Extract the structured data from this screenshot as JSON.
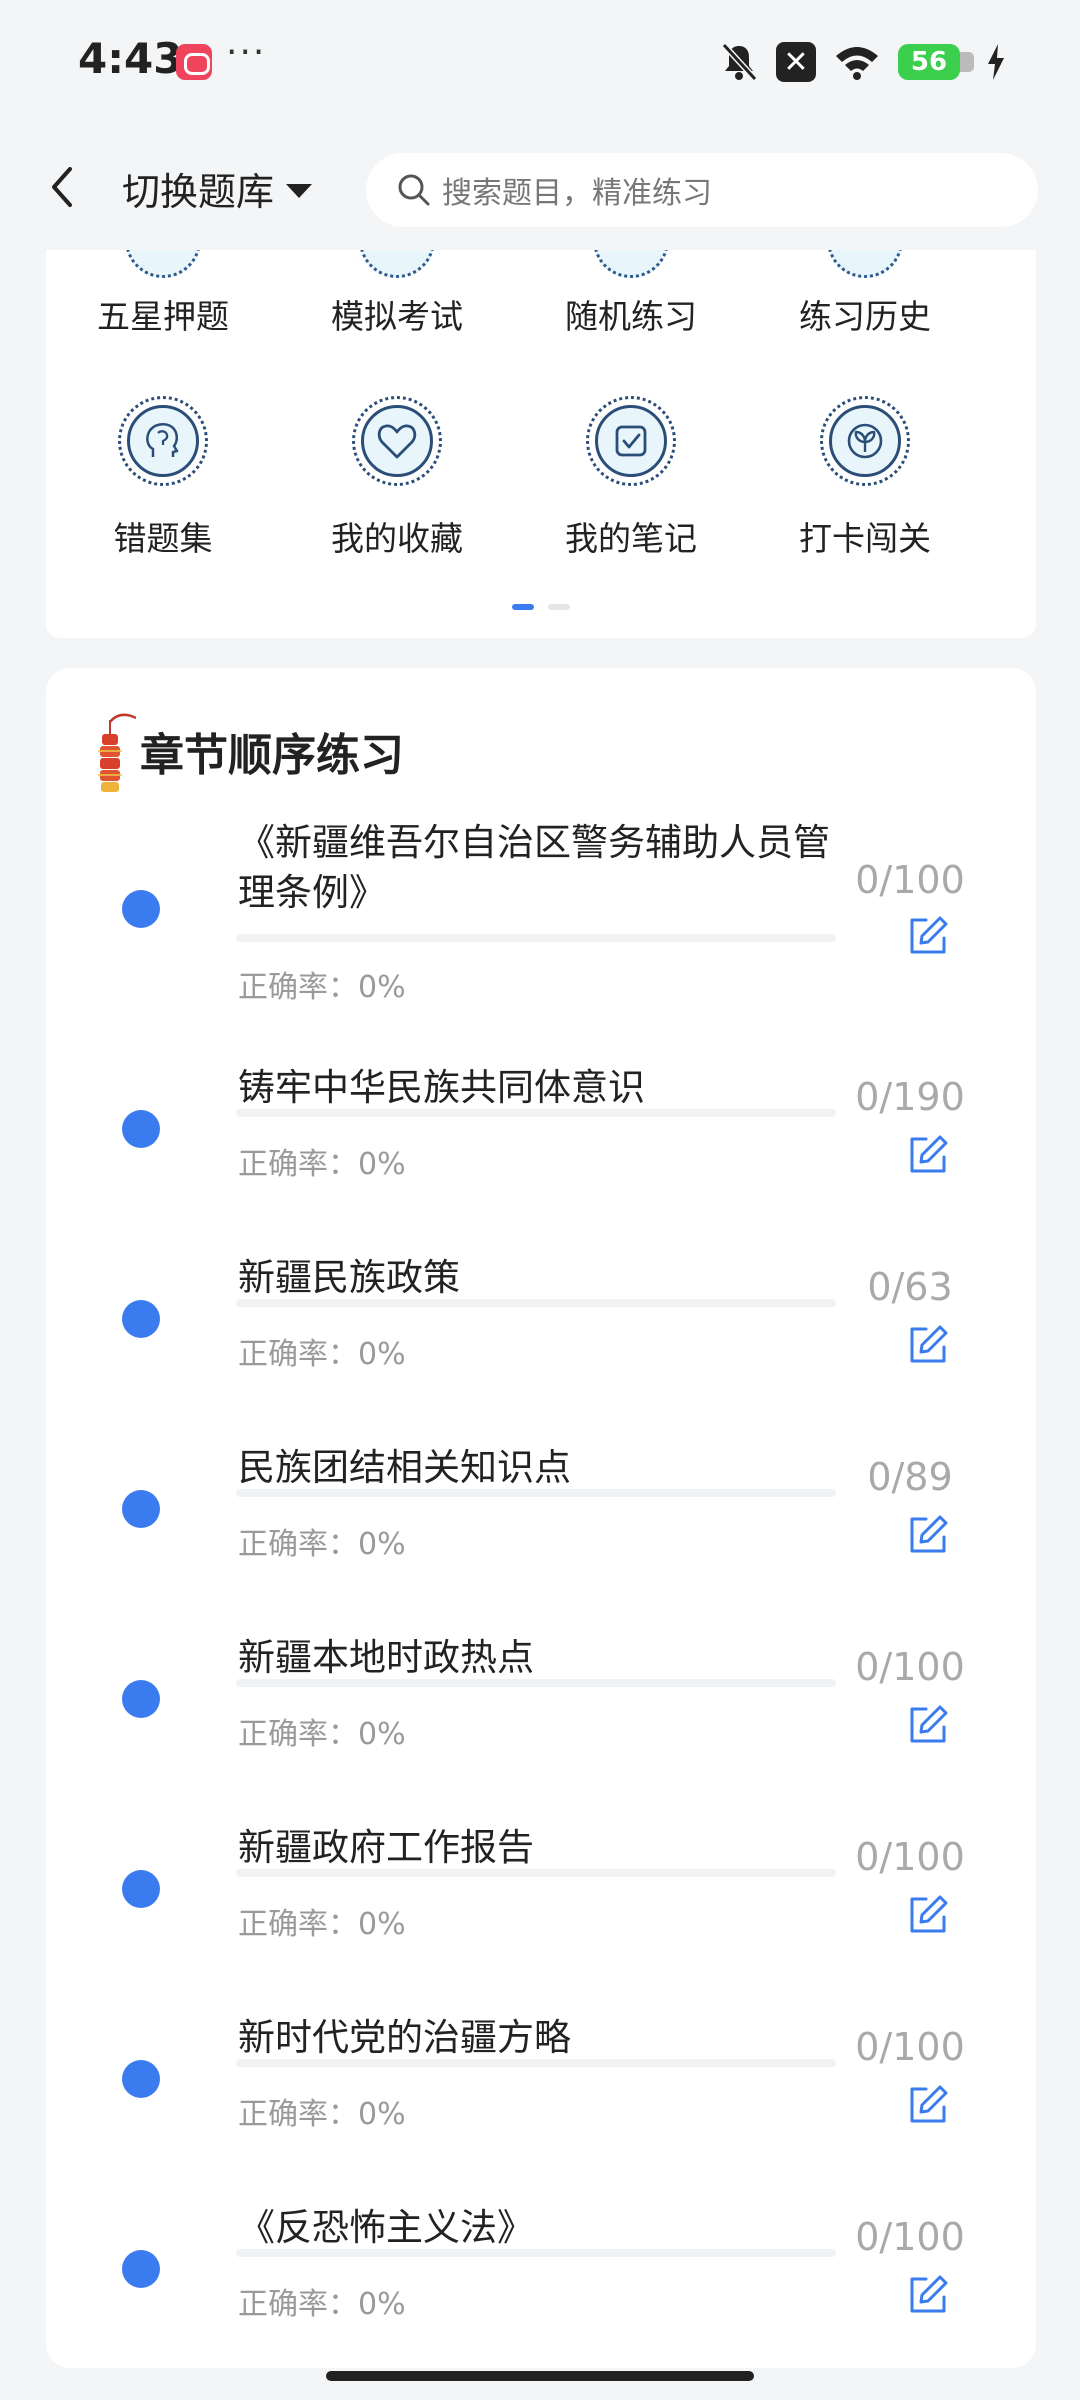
{
  "status_bar": {
    "time": "4:43",
    "dots": "···",
    "battery": "56"
  },
  "header": {
    "switch_bank_label": "切换题库",
    "search_placeholder": "搜索题目，精准练习"
  },
  "quick_grid": {
    "row1": [
      {
        "label": "五星押题",
        "icon": "star-exam-icon"
      },
      {
        "label": "模拟考试",
        "icon": "mock-exam-icon"
      },
      {
        "label": "随机练习",
        "icon": "random-practice-icon"
      },
      {
        "label": "练习历史",
        "icon": "history-icon"
      }
    ],
    "row2": [
      {
        "label": "错题集",
        "icon": "brain-head-icon"
      },
      {
        "label": "我的收藏",
        "icon": "heart-icon"
      },
      {
        "label": "我的笔记",
        "icon": "note-check-icon"
      },
      {
        "label": "打卡闯关",
        "icon": "sprout-icon"
      }
    ],
    "page_count": 2,
    "active_page": 1
  },
  "chapters": {
    "title": "章节顺序练习",
    "accuracy_label": "正确率：0%",
    "items": [
      {
        "title": "《新疆维吾尔自治区警务辅助人员管理条例》",
        "accuracy": "正确率：0%",
        "count": "0/100",
        "progress": 0
      },
      {
        "title": "铸牢中华民族共同体意识",
        "accuracy": "正确率：0%",
        "count": "0/190",
        "progress": 0
      },
      {
        "title": "新疆民族政策",
        "accuracy": "正确率：0%",
        "count": "0/63",
        "progress": 0
      },
      {
        "title": "民族团结相关知识点",
        "accuracy": "正确率：0%",
        "count": "0/89",
        "progress": 0
      },
      {
        "title": "新疆本地时政热点",
        "accuracy": "正确率：0%",
        "count": "0/100",
        "progress": 0
      },
      {
        "title": "新疆政府工作报告",
        "accuracy": "正确率：0%",
        "count": "0/100",
        "progress": 0
      },
      {
        "title": "新时代党的治疆方略",
        "accuracy": "正确率：0%",
        "count": "0/100",
        "progress": 0
      },
      {
        "title": "《反恐怖主义法》",
        "accuracy": "正确率：0%",
        "count": "0/100",
        "progress": 0
      }
    ]
  },
  "colors": {
    "accent": "#3a7cf0",
    "muted_text": "#9a9a9a",
    "background": "#f4f5f7"
  }
}
